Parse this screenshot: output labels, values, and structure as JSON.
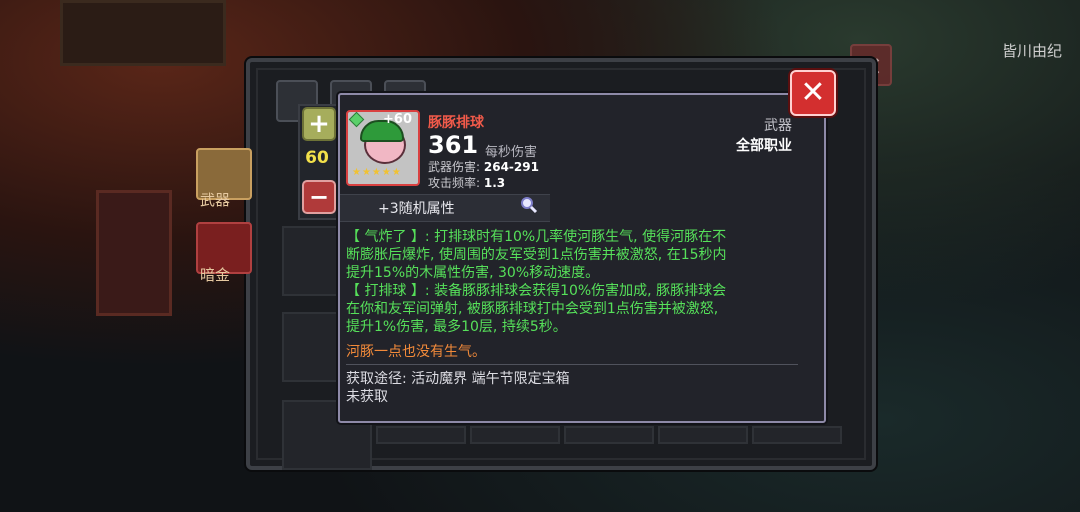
{
  "player": {
    "name": "皆川由纪"
  },
  "inventory": {
    "tabs": [
      {
        "label": "武器"
      },
      {
        "label": "暗金"
      }
    ],
    "count": "60"
  },
  "weapon": {
    "name": "豚豚排球",
    "level_badge": "+60",
    "stars": "★★★★★",
    "dps": "361",
    "dps_label": "每秒伤害",
    "damage_label": "武器伤害:",
    "damage_value": "264-291",
    "rate_label": "攻击频率:",
    "rate_value": "1.3",
    "type": "武器",
    "class": "全部职业",
    "random_attr": "+3随机属性",
    "desc": [
      "【 气炸了 】: 打排球时有10%几率使河豚生气, 使得河豚在不",
      "断膨胀后爆炸, 使周围的友军受到1点伤害并被激怒, 在15秒内",
      "提升15%的木属性伤害, 30%移动速度。",
      "【 打排球 】: 装备豚豚排球会获得10%伤害加成, 豚豚排球会",
      "在你和友军间弹射, 被豚豚排球打中会受到1点伤害并被激怒,",
      "提升1%伤害, 最多10层, 持续5秒。"
    ],
    "flavor": "河豚一点也没有生气。",
    "source": "获取途径: 活动魔界 端午节限定宝箱",
    "status": "未获取"
  },
  "colors": {
    "name": "#f05a4a",
    "desc": "#56e05a",
    "flavor": "#f28a3a",
    "count": "#f2e04a"
  },
  "icons": [
    "close-icon",
    "plus-icon",
    "minus-icon",
    "search-icon",
    "gem-icon",
    "star-icon"
  ]
}
